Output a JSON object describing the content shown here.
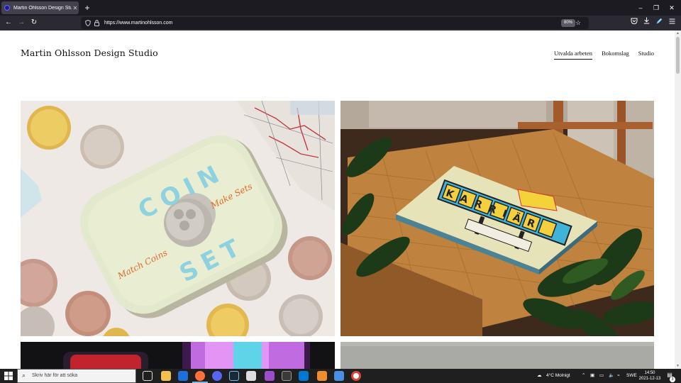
{
  "browser": {
    "tab_title": "Martin Ohlsson Design Studio",
    "tab_close": "✕",
    "new_tab": "+",
    "url": "https://www.martinohlsson.com",
    "zoom": "80%",
    "window_controls": {
      "minimize": "–",
      "restore": "❐",
      "close": "✕"
    },
    "nav_icons": {
      "back": "←",
      "forward": "→",
      "reload": "↻"
    }
  },
  "site": {
    "title": "Martin Ohlsson Design Studio",
    "nav": [
      {
        "label": "Utvalda arbeten",
        "active": true
      },
      {
        "label": "Bokomslag",
        "active": false
      },
      {
        "label": "Studio",
        "active": false
      }
    ]
  },
  "portfolio": {
    "coin_tin": {
      "word1": "COIN",
      "word2": "SET",
      "script1": "Make Sets",
      "script2": "Match Coins"
    },
    "karriar_box": {
      "title": "KARRIÄR"
    }
  },
  "taskbar": {
    "search_placeholder": "Skriv här för att söka",
    "weather": "4°C  Molnigt",
    "lang": "SWE",
    "time": "14:50",
    "date": "2021-12-13",
    "notif_count": "3"
  },
  "colors": {
    "tab_bar": "#1c1b22",
    "toolbar": "#2b2a33",
    "taskbar": "#1f1f1f",
    "accent_blue": "#76b9ed"
  }
}
